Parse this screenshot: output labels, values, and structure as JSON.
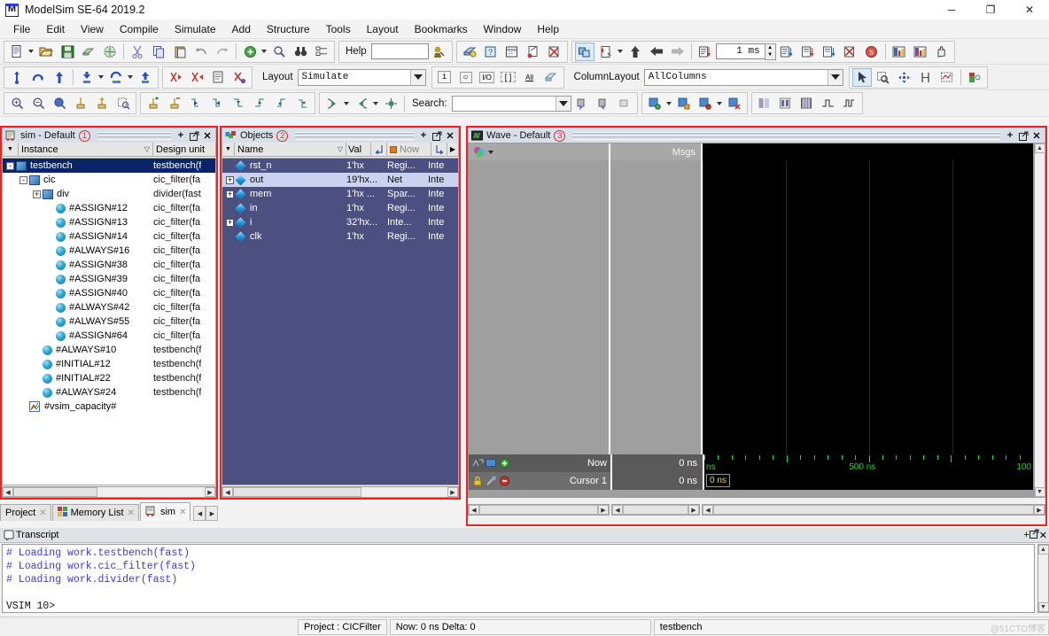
{
  "window": {
    "title": "ModelSim SE-64 2019.2",
    "app_icon": "modelsim-logo-icon",
    "minimize": "─",
    "maximize": "❐",
    "close": "✕"
  },
  "menubar": {
    "items": [
      {
        "label": "File",
        "accel": "F"
      },
      {
        "label": "Edit",
        "accel": "E"
      },
      {
        "label": "View",
        "accel": "V"
      },
      {
        "label": "Compile",
        "accel": "C"
      },
      {
        "label": "Simulate",
        "accel": "S"
      },
      {
        "label": "Add",
        "accel": "d"
      },
      {
        "label": "Structure",
        "accel": "u"
      },
      {
        "label": "Tools",
        "accel": "o"
      },
      {
        "label": "Layout",
        "accel": "u"
      },
      {
        "label": "Bookmarks",
        "accel": "k"
      },
      {
        "label": "Window",
        "accel": "W"
      },
      {
        "label": "Help",
        "accel": "H"
      }
    ]
  },
  "toolbar1": {
    "help_label": "Help",
    "help_value": "",
    "time_value": "1 ms",
    "icons": [
      "new-file-icon",
      "open-folder-icon",
      "save-icon",
      "compile-icon",
      "compile-all-icon",
      "cut-icon",
      "copy-icon",
      "paste-icon",
      "undo-icon",
      "redo-icon",
      "add-icon",
      "find-icon",
      "find-next-icon",
      "bookmark-icon",
      "goto-icon",
      "help-search-icon",
      "simulate-icon",
      "restart-icon",
      "break-icon",
      "stop-icon",
      "step-icon"
    ]
  },
  "toolbar2": {
    "layout_label": "Layout",
    "layout_value": "Simulate",
    "columnlayout_label": "ColumnLayout",
    "columnlayout_value": "AllColumns",
    "filter_buttons": [
      "i",
      "O",
      "I/O",
      "[]",
      "All"
    ]
  },
  "toolbar3": {
    "search_label": "Search:",
    "search_value": ""
  },
  "sim_panel": {
    "title": "sim - Default",
    "badge": "1",
    "icon": "sim-window-icon",
    "columns": [
      {
        "label": "Instance",
        "sort": "▽"
      },
      {
        "label": "Design unit"
      }
    ],
    "rows": [
      {
        "name": "testbench",
        "unit": "testbench(f",
        "depth": 0,
        "expander": "-",
        "icon": "module-icon",
        "selected": true
      },
      {
        "name": "cic",
        "unit": "cic_filter(fa",
        "depth": 1,
        "expander": "-",
        "icon": "module-icon"
      },
      {
        "name": "div",
        "unit": "divider(fast",
        "depth": 2,
        "expander": "+",
        "icon": "module-icon"
      },
      {
        "name": "#ASSIGN#12",
        "unit": "cic_filter(fa",
        "depth": 3,
        "expander": "",
        "icon": "process-icon"
      },
      {
        "name": "#ASSIGN#13",
        "unit": "cic_filter(fa",
        "depth": 3,
        "expander": "",
        "icon": "process-icon"
      },
      {
        "name": "#ASSIGN#14",
        "unit": "cic_filter(fa",
        "depth": 3,
        "expander": "",
        "icon": "process-icon"
      },
      {
        "name": "#ALWAYS#16",
        "unit": "cic_filter(fa",
        "depth": 3,
        "expander": "",
        "icon": "process-icon"
      },
      {
        "name": "#ASSIGN#38",
        "unit": "cic_filter(fa",
        "depth": 3,
        "expander": "",
        "icon": "process-icon"
      },
      {
        "name": "#ASSIGN#39",
        "unit": "cic_filter(fa",
        "depth": 3,
        "expander": "",
        "icon": "process-icon"
      },
      {
        "name": "#ASSIGN#40",
        "unit": "cic_filter(fa",
        "depth": 3,
        "expander": "",
        "icon": "process-icon"
      },
      {
        "name": "#ALWAYS#42",
        "unit": "cic_filter(fa",
        "depth": 3,
        "expander": "",
        "icon": "process-icon"
      },
      {
        "name": "#ALWAYS#55",
        "unit": "cic_filter(fa",
        "depth": 3,
        "expander": "",
        "icon": "process-icon"
      },
      {
        "name": "#ASSIGN#64",
        "unit": "cic_filter(fa",
        "depth": 3,
        "expander": "",
        "icon": "process-icon"
      },
      {
        "name": "#ALWAYS#10",
        "unit": "testbench(f",
        "depth": 2,
        "expander": "",
        "icon": "process-icon"
      },
      {
        "name": "#INITIAL#12",
        "unit": "testbench(f",
        "depth": 2,
        "expander": "",
        "icon": "process-icon"
      },
      {
        "name": "#INITIAL#22",
        "unit": "testbench(f",
        "depth": 2,
        "expander": "",
        "icon": "process-icon"
      },
      {
        "name": "#ALWAYS#24",
        "unit": "testbench(f",
        "depth": 2,
        "expander": "",
        "icon": "process-icon"
      },
      {
        "name": "#vsim_capacity#",
        "unit": "",
        "depth": 1,
        "expander": "",
        "icon": "capacity-icon"
      }
    ]
  },
  "objects_panel": {
    "title": "Objects",
    "badge": "2",
    "icon": "objects-window-icon",
    "columns": [
      {
        "label": "Name",
        "sort": "▽"
      },
      {
        "label": "Val"
      },
      {
        "label": "Now"
      }
    ],
    "rows": [
      {
        "name": "rst_n",
        "value": "1'hx",
        "kind": "Regi...",
        "scope": "Inte",
        "expander": "",
        "highlight": false
      },
      {
        "name": "out",
        "value": "19'hx...",
        "kind": "Net",
        "scope": "Inte",
        "expander": "+",
        "highlight": true
      },
      {
        "name": "mem",
        "value": "1'hx ...",
        "kind": "Spar...",
        "scope": "Inte",
        "expander": "+",
        "highlight": false
      },
      {
        "name": "in",
        "value": "1'hx",
        "kind": "Regi...",
        "scope": "Inte",
        "expander": "",
        "highlight": false
      },
      {
        "name": "i",
        "value": "32'hx...",
        "kind": "Inte...",
        "scope": "Inte",
        "expander": "+",
        "highlight": false
      },
      {
        "name": "clk",
        "value": "1'hx",
        "kind": "Regi...",
        "scope": "Inte",
        "expander": "",
        "highlight": false
      }
    ]
  },
  "wave_panel": {
    "title": "Wave - Default",
    "badge": "3",
    "icon": "wave-window-icon",
    "msgs_header": "Msgs",
    "now_label": "Now",
    "now_value": "0 ns",
    "cursor_label": "Cursor 1",
    "cursor_value": "0 ns",
    "cursor_badge": "0 ns",
    "timeline": {
      "unit_label": "ns",
      "labels": [
        "500 ns",
        "100"
      ],
      "major_ticks": [
        125,
        250,
        375
      ],
      "range_start": "0 ns",
      "range_end": "1000 ns"
    }
  },
  "bottom_tabs": {
    "items": [
      {
        "label": "Project",
        "icon": "",
        "active": false
      },
      {
        "label": "Memory List",
        "icon": "memory-grid-icon",
        "active": false
      },
      {
        "label": "sim",
        "icon": "sim-window-icon",
        "active": true
      }
    ],
    "nav_prev": "◀",
    "nav_next": "▶"
  },
  "transcript": {
    "title": "Transcript",
    "icon": "transcript-icon",
    "lines": [
      "# Loading work.testbench(fast)",
      "# Loading work.cic_filter(fast)",
      "# Loading work.divider(fast)",
      ""
    ],
    "prompt": "VSIM 10>"
  },
  "statusbar": {
    "project": "Project : CICFilter",
    "now_delta": "Now: 0 ns  Delta: 0",
    "context": "testbench"
  },
  "watermark": "@51CTO博客",
  "colors": {
    "accent_red": "#e82626",
    "objects_bg": "#4b5080",
    "tree_selection": "#0a246a",
    "wave_green": "#23d923",
    "transcript_text": "#3a3ad0"
  }
}
